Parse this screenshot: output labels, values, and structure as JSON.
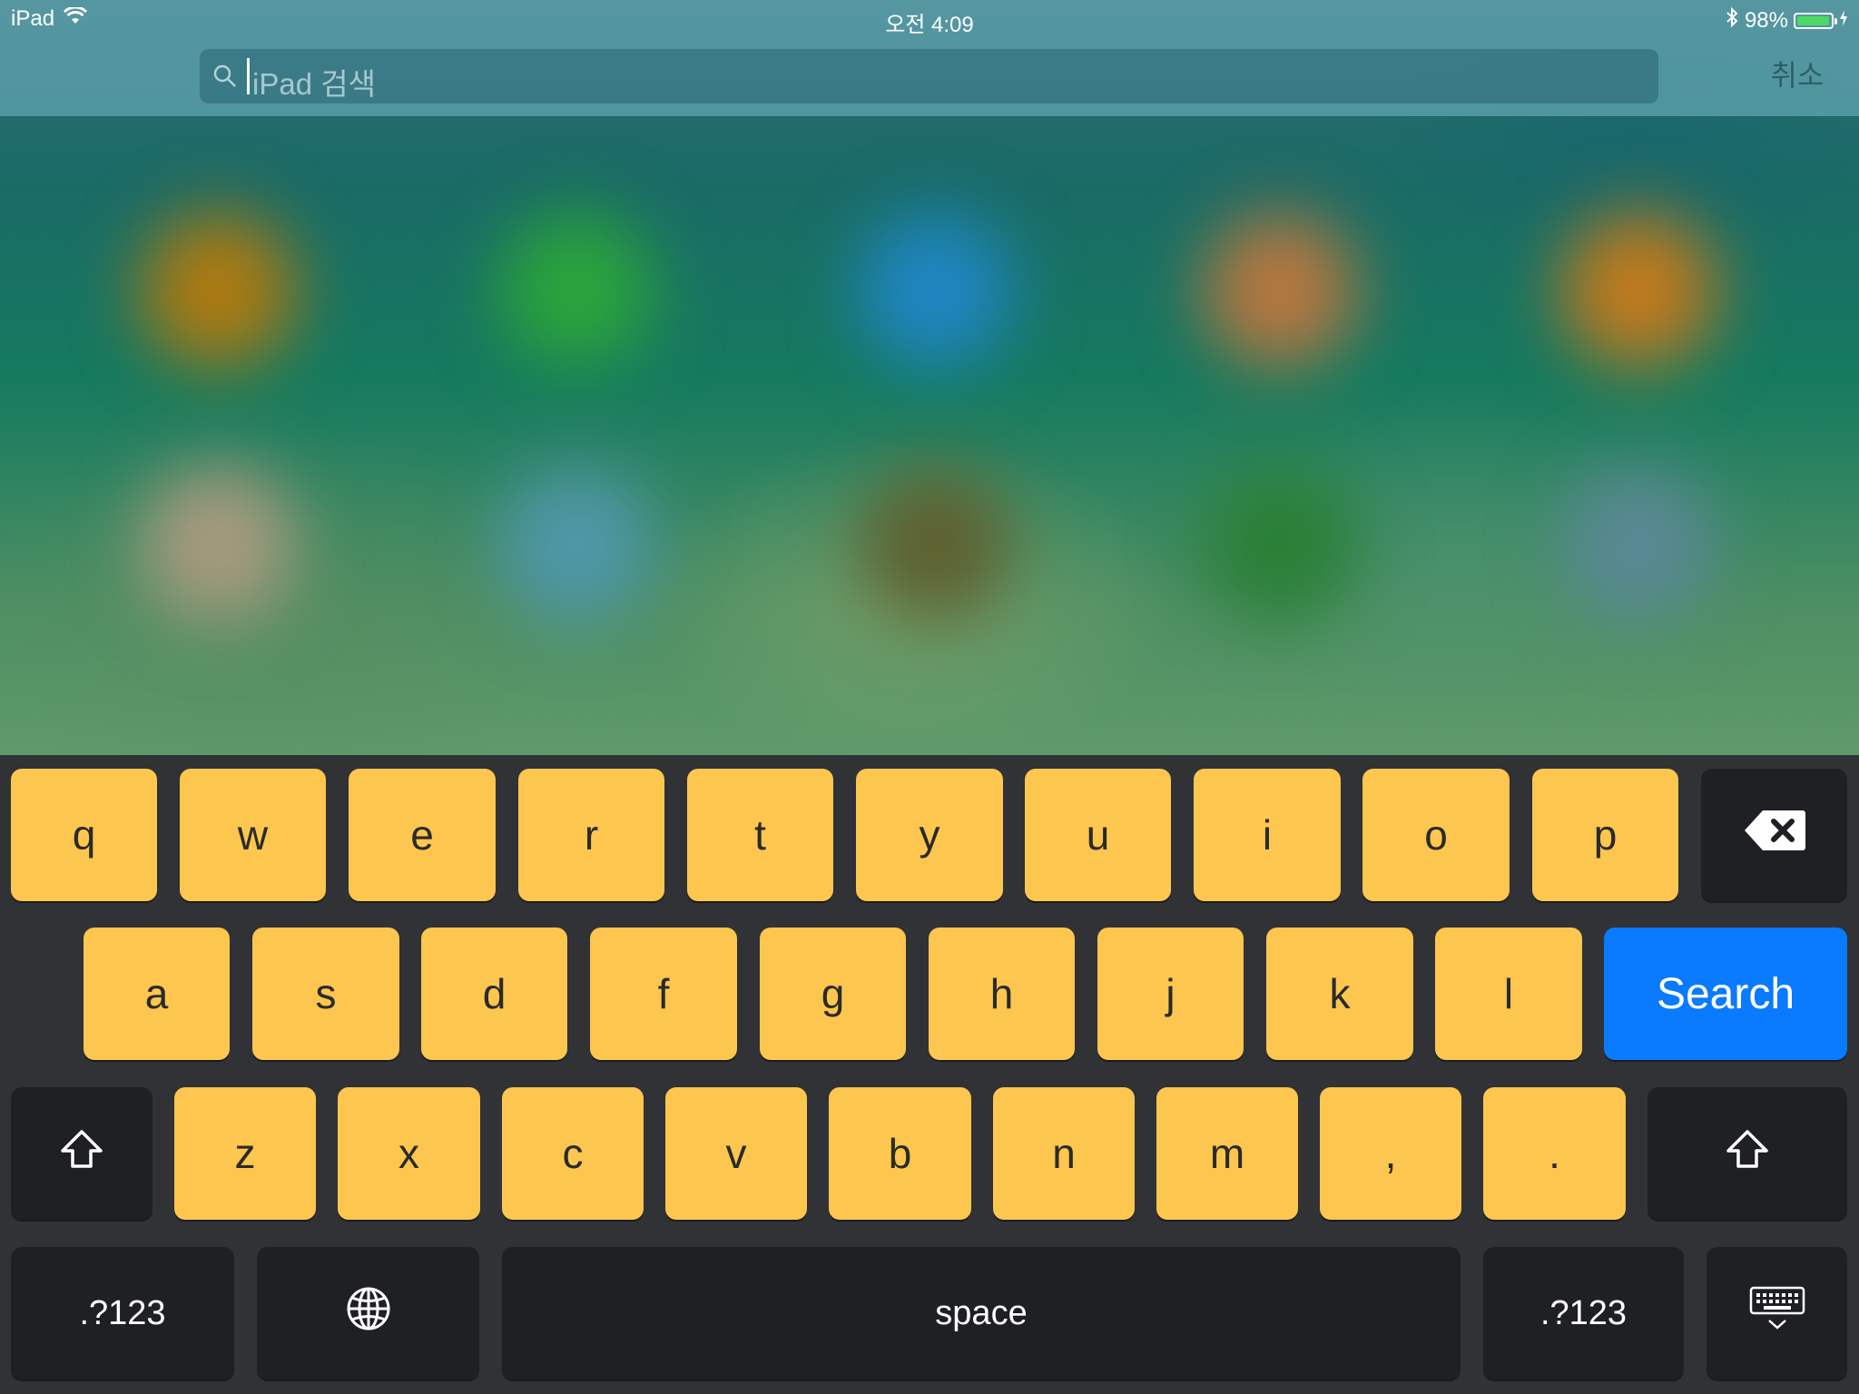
{
  "status_bar": {
    "device": "iPad",
    "time": "오전 4:09",
    "battery_percent": "98%",
    "battery_level": 0.98
  },
  "search": {
    "placeholder": "iPad 검색",
    "cancel_label": "취소"
  },
  "wallpaper": {
    "icon_colors": [
      "#b07a10",
      "#2ca53b",
      "#1f86c4",
      "#b8773f",
      "#c47a1c",
      "#a89a7e",
      "#4f97aa",
      "#5e6030",
      "#2a7f35",
      "#5a8895"
    ]
  },
  "keyboard": {
    "row1": [
      "q",
      "w",
      "e",
      "r",
      "t",
      "y",
      "u",
      "i",
      "o",
      "p"
    ],
    "row2": [
      "a",
      "s",
      "d",
      "f",
      "g",
      "h",
      "j",
      "k",
      "l"
    ],
    "row3": [
      "z",
      "x",
      "c",
      "v",
      "b",
      "n",
      "m",
      ",",
      "."
    ],
    "search_label": "Search",
    "numbers_label_left": ".?123",
    "numbers_label_right": ".?123",
    "space_label": "space",
    "icons": {
      "delete": "backspace-icon",
      "shift": "shift-arrow-icon",
      "globe": "globe-icon",
      "dismiss": "keyboard-dismiss-icon"
    },
    "colors": {
      "letter_key": "#fdc64e",
      "function_key": "#1f2023",
      "search_key": "#0a7aff",
      "background": "#303236"
    }
  }
}
